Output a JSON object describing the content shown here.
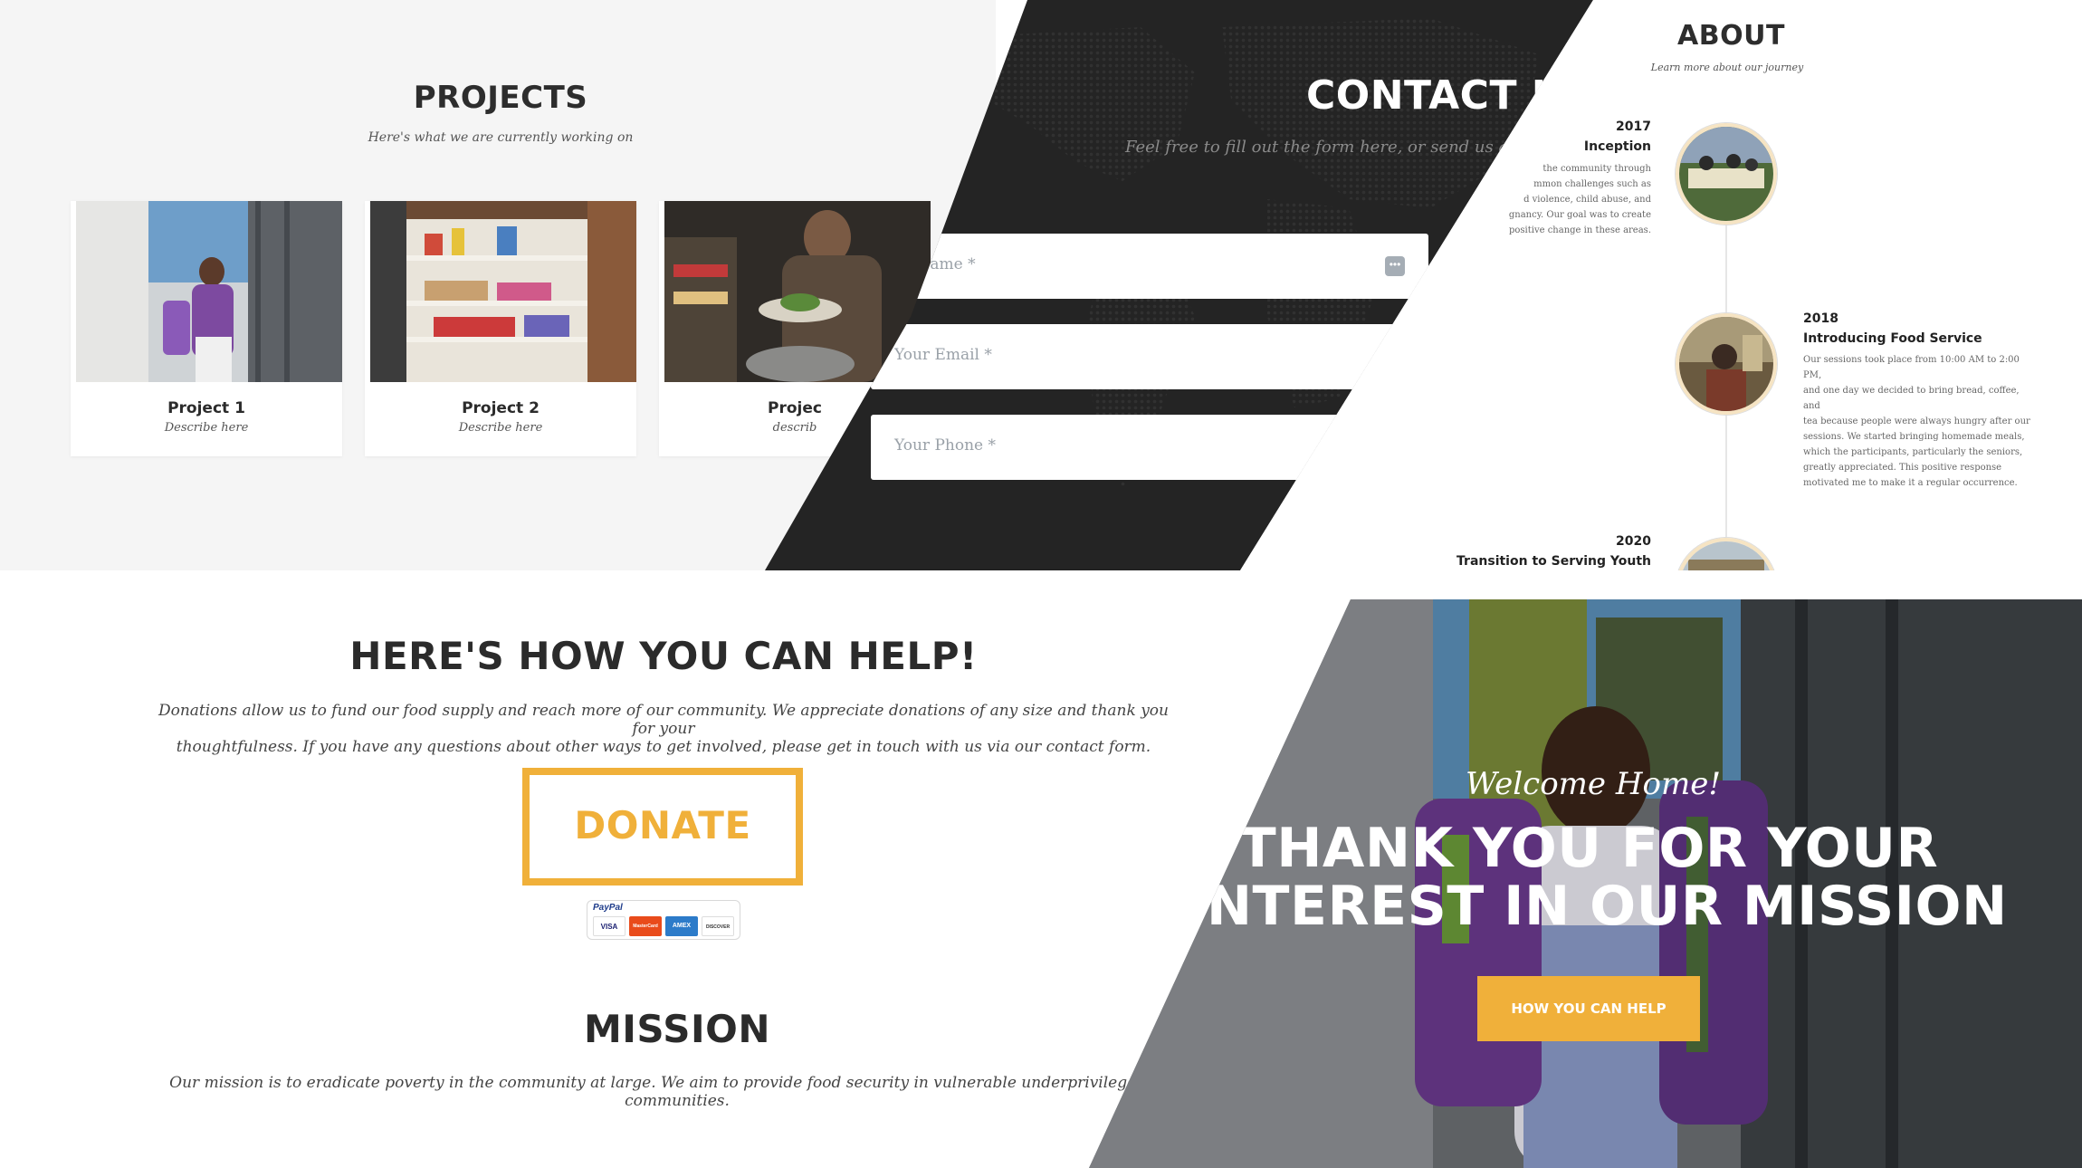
{
  "projects": {
    "title": "PROJECTS",
    "subtitle": "Here's what we are currently working on",
    "cards": [
      {
        "name": "Project 1",
        "desc": "Describe here"
      },
      {
        "name": "Project 2",
        "desc": "Describe here"
      },
      {
        "name": "Projec",
        "desc": "describ"
      }
    ]
  },
  "contact": {
    "title": "CONTACT U",
    "subtitle": "Feel free to fill out the form here, or send us an email",
    "name_placeholder": "ur Name *",
    "email_placeholder": "Your Email *",
    "phone_placeholder": "Your Phone *"
  },
  "about": {
    "title": "ABOUT",
    "subtitle": "Learn more about our journey",
    "events": [
      {
        "year": "2017",
        "title": "Inception",
        "lines": [
          "the community through",
          "mmon challenges such as",
          "d violence, child abuse, and",
          "gnancy. Our goal was to create",
          "positive change in these areas."
        ]
      },
      {
        "year": "2018",
        "title": "Introducing Food Service",
        "lines": [
          "Our sessions took place from 10:00 AM to 2:00 PM,",
          "and one day we decided to bring bread, coffee, and",
          "tea because people were always hungry after our",
          "sessions. We started bringing homemade meals,",
          "which the participants, particularly the seniors,",
          "greatly appreciated. This positive response",
          "motivated me to make it a regular occurrence."
        ]
      },
      {
        "year": "2020",
        "title": "Transition to Serving Youth",
        "lines": []
      }
    ]
  },
  "help": {
    "title": "HERE'S HOW YOU CAN HELP!",
    "text_line1": "Donations allow us to fund our food supply and reach more of our community. We appreciate donations of any size and thank you for your",
    "text_line2": "thoughtfulness. If you have any questions about other ways to get involved, please get in touch with us via our contact form.",
    "donate_label": "DONATE",
    "paypal_label": "PayPal",
    "cards": [
      "VISA",
      "MasterCard",
      "AMEX",
      "DISCOVER"
    ]
  },
  "mission": {
    "title": "MISSION",
    "text_line1": "Our mission is to eradicate poverty in the community at large. We aim to provide food security in vulnerable underprivileged, and",
    "text_line2": "communities."
  },
  "hero": {
    "welcome": "Welcome Home!",
    "line1": "THANK YOU FOR YOUR",
    "line2": "INTEREST IN OUR MISSION",
    "cta": "HOW YOU CAN HELP"
  },
  "colors": {
    "accent": "#f0b03a",
    "dark": "#242424",
    "light_bg": "#f5f5f5"
  }
}
